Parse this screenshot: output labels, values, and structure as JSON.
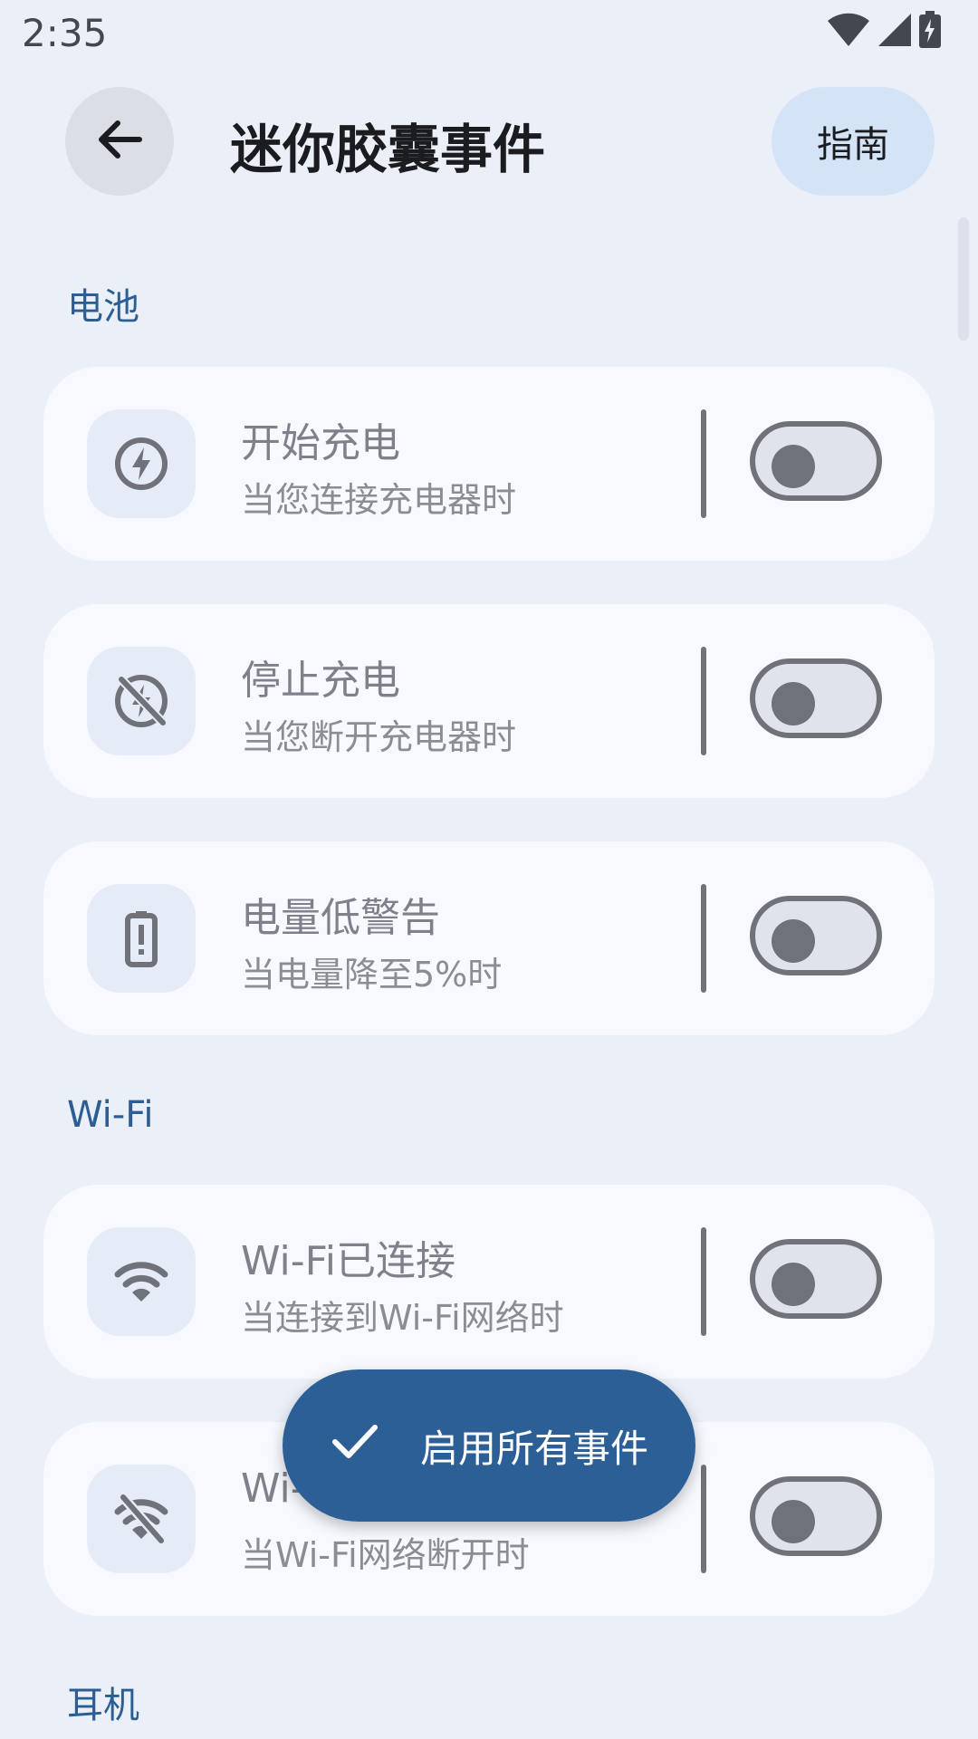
{
  "status_bar": {
    "time": "2:35"
  },
  "header": {
    "title": "迷你胶囊事件",
    "guide_label": "指南"
  },
  "sections": [
    {
      "title": "电池",
      "items": [
        {
          "icon": "bolt-circle-icon",
          "title": "开始充电",
          "subtitle": "当您连接充电器时",
          "enabled": false
        },
        {
          "icon": "bolt-off-icon",
          "title": "停止充电",
          "subtitle": "当您断开充电器时",
          "enabled": false
        },
        {
          "icon": "battery-alert-icon",
          "title": "电量低警告",
          "subtitle": "当电量降至5%时",
          "enabled": false
        }
      ]
    },
    {
      "title": "Wi-Fi",
      "items": [
        {
          "icon": "wifi-icon",
          "title": "Wi-Fi已连接",
          "subtitle": "当连接到Wi-Fi网络时",
          "enabled": false
        },
        {
          "icon": "wifi-off-icon",
          "title": "Wi-",
          "subtitle": "当Wi-Fi网络断开时",
          "enabled": false
        }
      ]
    },
    {
      "title": "耳机",
      "items": []
    }
  ],
  "fab": {
    "label": "启用所有事件",
    "icon": "check-icon"
  },
  "colors": {
    "accent": "#2C5F96",
    "background": "#EAEFF8",
    "card": "#F7F9FF"
  }
}
